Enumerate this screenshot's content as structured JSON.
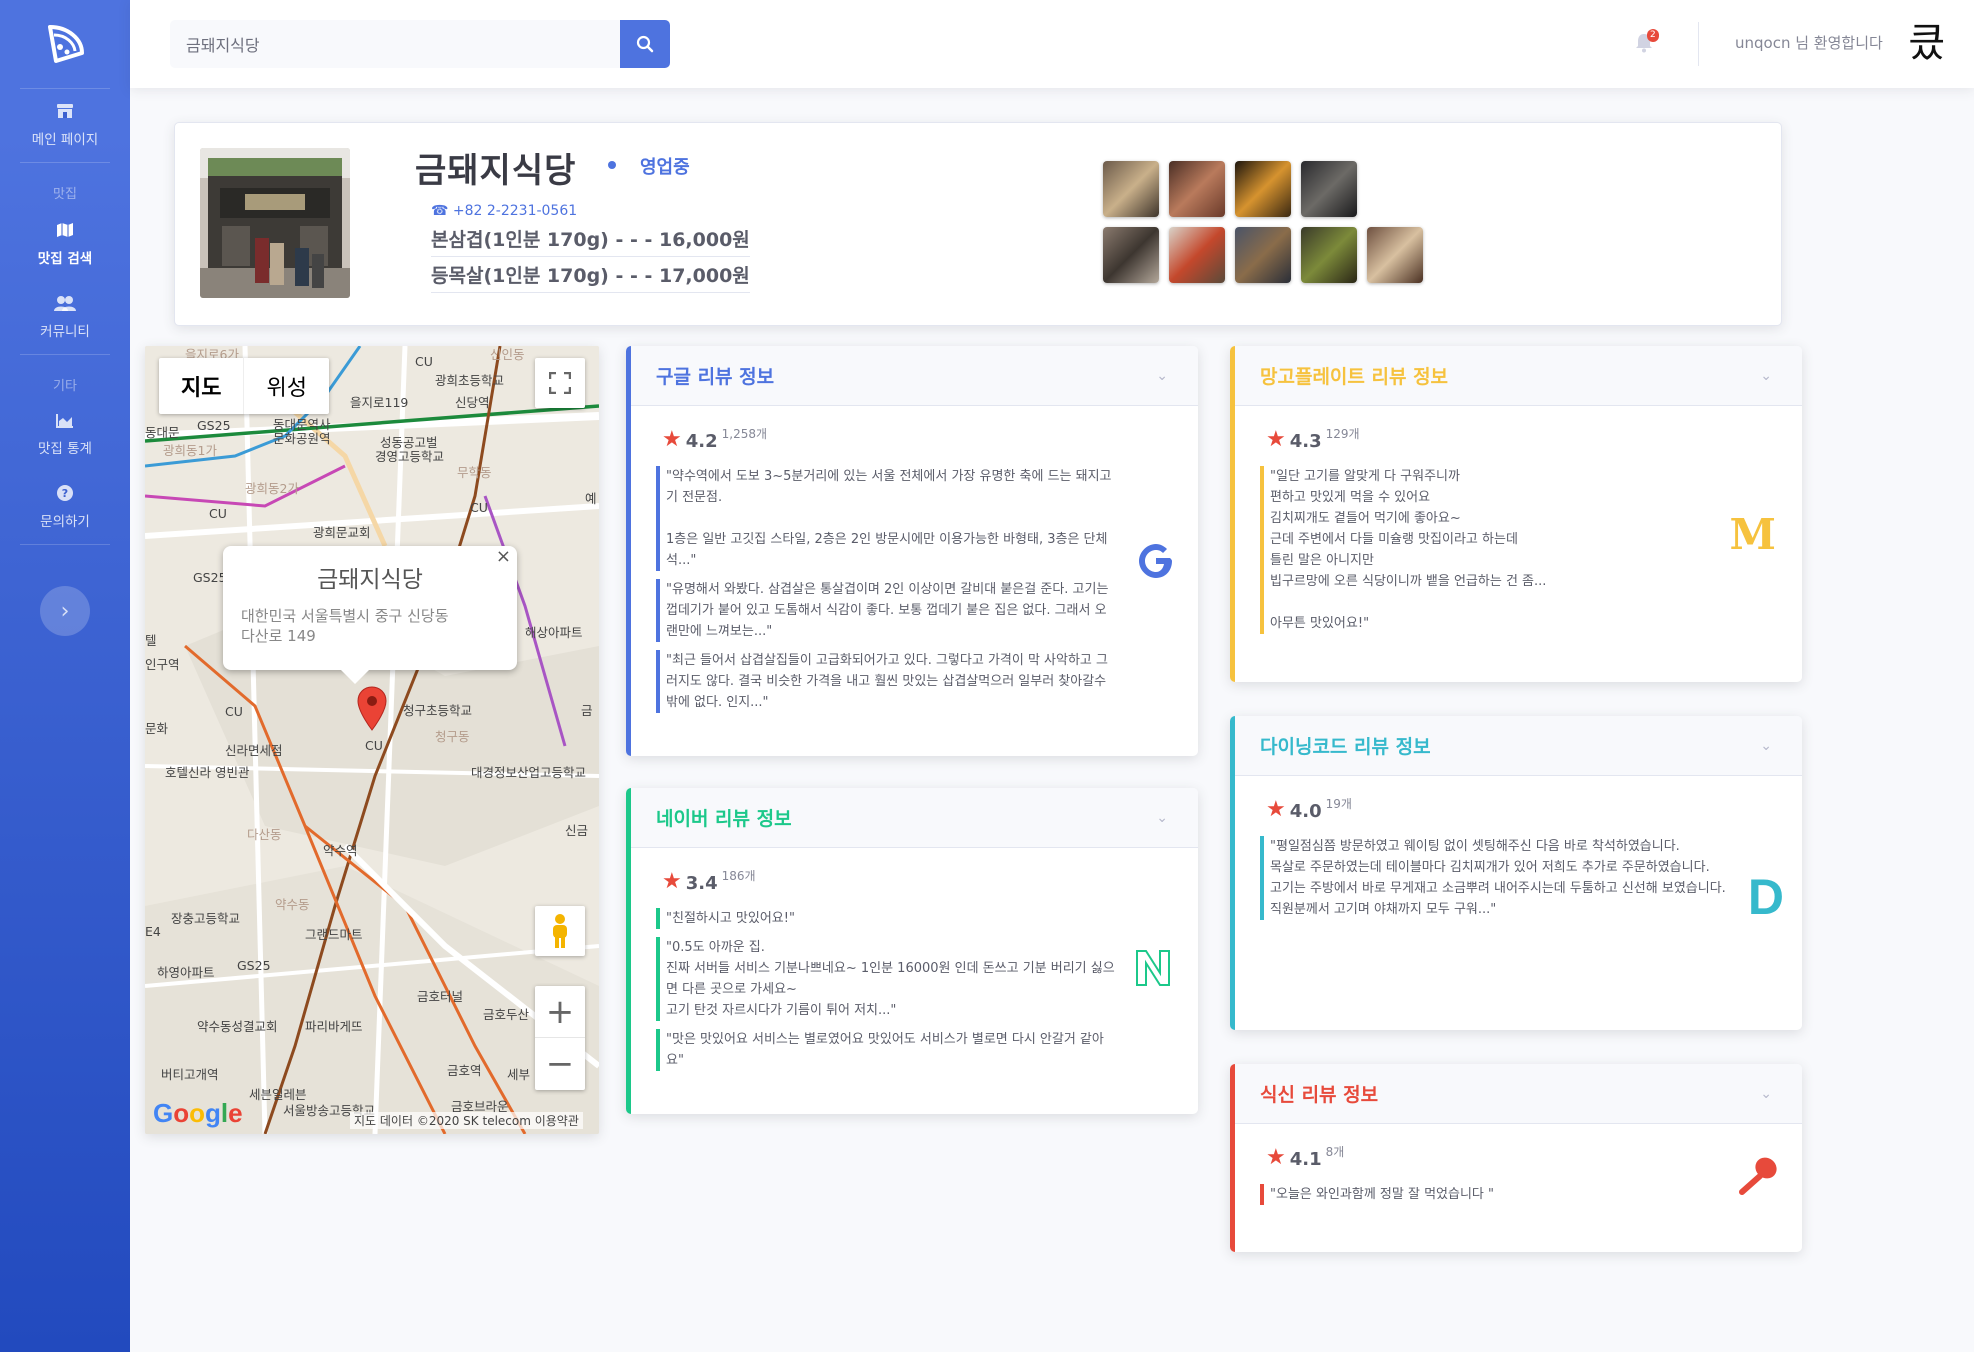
{
  "sidebar": {
    "nav": [
      {
        "label": "메인 페이지",
        "icon": "store-icon"
      },
      {
        "label": "맛집 검색",
        "icon": "map-icon",
        "active": true
      },
      {
        "label": "커뮤니티",
        "icon": "users-icon"
      },
      {
        "label": "맛집 통계",
        "icon": "chart-area-icon"
      },
      {
        "label": "문의하기",
        "icon": "question-circle-icon"
      }
    ],
    "headings": {
      "restaurants": "맛집",
      "etc": "기타"
    }
  },
  "topbar": {
    "search_value": "금돼지식당",
    "notification_count": "2",
    "welcome": "unqocn 님 환영합니다",
    "avatar_glyph": "킀"
  },
  "restaurant": {
    "name": "금돼지식당",
    "status": "영업중",
    "phone": "☎ +82 2-2231-0561",
    "menu": [
      "본삼겹(1인분 170g) - - - 16,000원",
      "등목살(1인분 170g) - - - 17,000원"
    ]
  },
  "map": {
    "type_buttons": [
      "지도",
      "위성"
    ],
    "info_title": "금돼지식당",
    "info_address": "대한민국 서울특별시 중구 신당동\n다산로 149",
    "logo": "Google",
    "attribution": "지도 데이터 ©2020 SK telecom   이용약관",
    "labels": {
      "l1": "을지로6가",
      "l2": "신인동",
      "l3": "CU",
      "l4": "광희초등학교",
      "l5": "을지로119",
      "l6": "신당역",
      "l7": "동대문",
      "l8": "GS25",
      "l9": "동대문역사\n문화공원역",
      "l10": "성동공고벌",
      "l11": "경영고등학교",
      "l12": "광희동1가",
      "l13": "광희동2가",
      "l14": "무학동",
      "l15": "CU",
      "l16": "CU",
      "l17": "광희문교회",
      "l18": "예",
      "l19": "GS25",
      "l20": "인구역",
      "l21": "텔",
      "l22": "청구초등학교",
      "l23": "청구동",
      "l24": "CU",
      "l25": "CU",
      "l26": "신라면세점",
      "l27": "호텔신라 영빈관",
      "l28": "대경정보산업고등학교",
      "l29": "다산동",
      "l30": "약수역",
      "l31": "신금",
      "l32": "장충고등학교",
      "l33": "약수동",
      "l34": "그랜드마트",
      "l35": "하영아파트",
      "l36": "GS25",
      "l37": "약수동성결교회",
      "l38": "파리바게뜨",
      "l39": "금호터널",
      "l40": "금호두산",
      "l41": "버티고개역",
      "l42": "세븐일레븐",
      "l43": "금호역",
      "l44": "세부",
      "l45": "서울방송고등학교",
      "l46": "금호브라운",
      "l47": "E4",
      "l48": "문화",
      "l49": "금",
      "l50": "해상아파트"
    }
  },
  "reviews": {
    "google": {
      "title": "구글 리뷰 정보",
      "score": "4.2",
      "count": "1,258개",
      "quotes": [
        "\"약수역에서 도보 3~5분거리에 있는 서울 전체에서 가장 유명한 축에 드는 돼지고기 전문점.\n\n1층은 일반 고깃집 스타일, 2층은 2인 방문시에만 이용가능한 바형태, 3층은 단체석...\"",
        "\"유명해서 와봤다. 삼겹살은 통살겹이며 2인 이상이면 갈비대 붙은걸 준다. 고기는 껍데기가 붙어 있고 도톰해서 식감이 좋다. 보통 껍데기 붙은 집은 없다. 그래서 오랜만에 느껴보는...\"",
        "\"최근 들어서 삽겹살집들이 고급화되어가고 있다. 그렇다고 가격이 막 사악하고 그러지도 않다. 결국 비슷한 가격을 내고 훨씬 맛있는 삽겹살먹으러 일부러 찾아갈수 밖에 없다. 인지...\""
      ]
    },
    "naver": {
      "title": "네이버 리뷰 정보",
      "score": "3.4",
      "count": "186개",
      "quotes": [
        "\"친절하시고 맛있어요!\"",
        "\"0.5도 아까운 집.\n진짜 서버들 서비스 기분나쁘네요~ 1인분 16000원 인데 돈쓰고 기분 버리기 싫으면 다른 곳으로 가세요~\n고기 탄것 자르시다가 기름이 튀어 저치...\"",
        "\"맛은 맛있어요 서비스는 별로였어요 맛있어도 서비스가 별로면 다시 안갈거 같아요\""
      ]
    },
    "mango": {
      "title": "망고플레이트 리뷰 정보",
      "score": "4.3",
      "count": "129개",
      "logo": "M",
      "quotes": [
        "\"일단 고기를 알맞게 다 구워주니까\n편하고 맛있게 먹을 수 있어요\n김치찌개도 곁들어 먹기에 좋아요~\n근데 주변에서 다들 미슐랭 맛집이라고 하는데\n틀린 말은 아니지만\n빕구르망에 오른 식당이니까 뱉을 언급하는 건 좀...\n\n아무튼 맛있어요!\""
      ]
    },
    "dining": {
      "title": "다이닝코드 리뷰 정보",
      "score": "4.0",
      "count": "19개",
      "logo": "D",
      "quotes": [
        "\"평일점심쯤 방문하였고 웨이팅 없이 셋팅해주신 다음 바로 착석하였습니다.\n목살로 주문하였는데 테이블마다 김치찌개가 있어 저희도 추가로 주문하였습니다.\n고기는 주방에서 바로 무게재고 소금뿌려 내어주시는데 두툼하고 신선해 보였습니다.\n직원분께서 고기며 야채까지 모두 구워...\""
      ]
    },
    "siksin": {
      "title": "식신 리뷰 정보",
      "score": "4.1",
      "count": "8개",
      "quotes": [
        "\"오늘은 와인과함께 정말 잘 먹었습니다 \""
      ]
    }
  },
  "colors": {
    "primary": "#4e73df",
    "google": "#4e73df",
    "naver": "#1cc88a",
    "mango": "#f6c23e",
    "dining": "#36b9cc",
    "siksin": "#e74a3b",
    "star": "#e74a3b"
  }
}
